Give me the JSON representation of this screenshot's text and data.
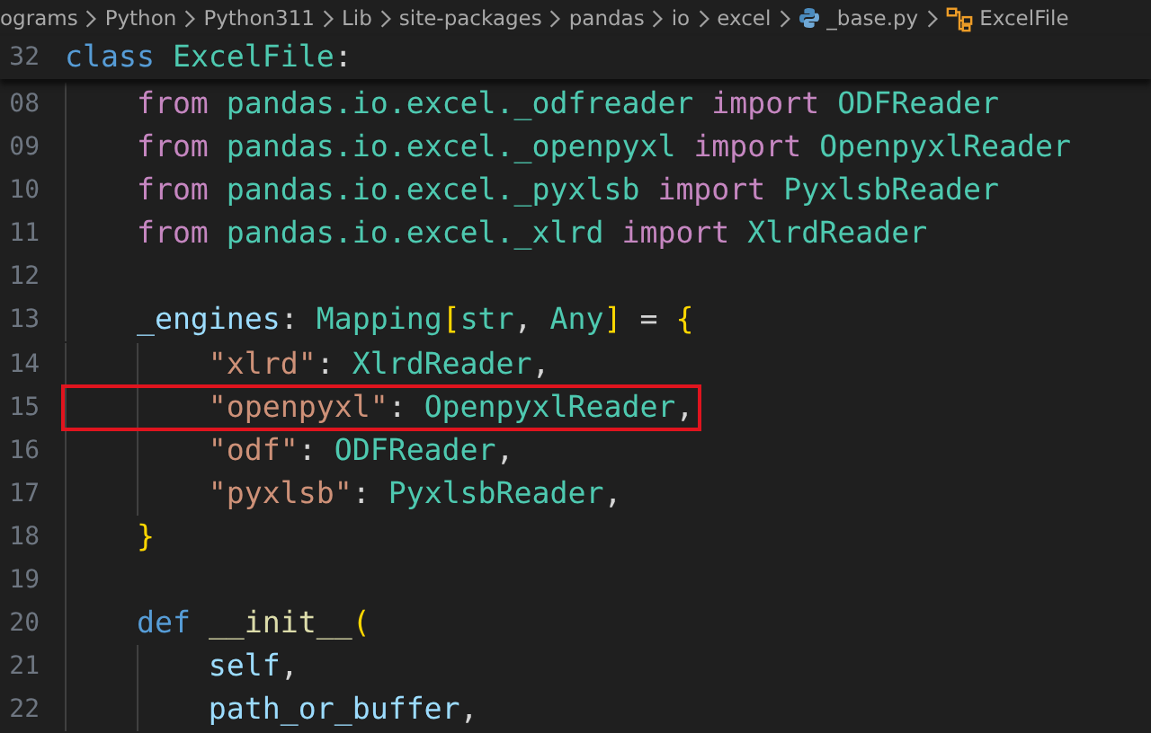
{
  "breadcrumbs": [
    {
      "label": "ograms",
      "kind": "folder"
    },
    {
      "label": "Python",
      "kind": "folder"
    },
    {
      "label": "Python311",
      "kind": "folder"
    },
    {
      "label": "Lib",
      "kind": "folder"
    },
    {
      "label": "site-packages",
      "kind": "folder"
    },
    {
      "label": "pandas",
      "kind": "folder"
    },
    {
      "label": "io",
      "kind": "folder"
    },
    {
      "label": "excel",
      "kind": "folder"
    },
    {
      "label": "_base.py",
      "kind": "python-file"
    },
    {
      "label": "ExcelFile",
      "kind": "class-symbol"
    }
  ],
  "sticky_line": {
    "number": "32",
    "tokens": [
      {
        "text": "class ",
        "kind": "keyword"
      },
      {
        "text": "ExcelFile",
        "kind": "type"
      },
      {
        "text": ":",
        "kind": "plain"
      }
    ]
  },
  "lines": [
    {
      "number": "08",
      "highlighted": false,
      "tokens": [
        {
          "text": "    from",
          "kind": "control"
        },
        {
          "text": " pandas.io.excel._odfreader ",
          "kind": "type"
        },
        {
          "text": "import",
          "kind": "control"
        },
        {
          "text": " ODFReader",
          "kind": "type"
        }
      ]
    },
    {
      "number": "09",
      "highlighted": false,
      "tokens": [
        {
          "text": "    from",
          "kind": "control"
        },
        {
          "text": " pandas.io.excel._openpyxl ",
          "kind": "type"
        },
        {
          "text": "import",
          "kind": "control"
        },
        {
          "text": " OpenpyxlReader",
          "kind": "type"
        }
      ]
    },
    {
      "number": "10",
      "highlighted": false,
      "tokens": [
        {
          "text": "    from",
          "kind": "control"
        },
        {
          "text": " pandas.io.excel._pyxlsb ",
          "kind": "type"
        },
        {
          "text": "import",
          "kind": "control"
        },
        {
          "text": " PyxlsbReader",
          "kind": "type"
        }
      ]
    },
    {
      "number": "11",
      "highlighted": false,
      "tokens": [
        {
          "text": "    from",
          "kind": "control"
        },
        {
          "text": " pandas.io.excel._xlrd ",
          "kind": "type"
        },
        {
          "text": "import",
          "kind": "control"
        },
        {
          "text": " XlrdReader",
          "kind": "type"
        }
      ]
    },
    {
      "number": "12",
      "highlighted": false
    },
    {
      "number": "13",
      "highlighted": false,
      "tokens": [
        {
          "text": "    _engines",
          "kind": "variable"
        },
        {
          "text": ": ",
          "kind": "plain"
        },
        {
          "text": "Mapping",
          "kind": "type"
        },
        {
          "text": "[",
          "kind": "bracket"
        },
        {
          "text": "str",
          "kind": "type"
        },
        {
          "text": ", ",
          "kind": "plain"
        },
        {
          "text": "Any",
          "kind": "type"
        },
        {
          "text": "]",
          "kind": "bracket"
        },
        {
          "text": " = ",
          "kind": "plain"
        },
        {
          "text": "{",
          "kind": "bracket"
        }
      ]
    },
    {
      "number": "14",
      "highlighted": false,
      "tokens": [
        {
          "text": "        \"xlrd\"",
          "kind": "string"
        },
        {
          "text": ": ",
          "kind": "plain"
        },
        {
          "text": "XlrdReader",
          "kind": "type"
        },
        {
          "text": ",",
          "kind": "plain"
        }
      ]
    },
    {
      "number": "15",
      "highlighted": true,
      "tokens": [
        {
          "text": "        \"openpyxl\"",
          "kind": "string"
        },
        {
          "text": ": ",
          "kind": "plain"
        },
        {
          "text": "OpenpyxlReader",
          "kind": "type"
        },
        {
          "text": ",",
          "kind": "plain"
        }
      ]
    },
    {
      "number": "16",
      "highlighted": false,
      "tokens": [
        {
          "text": "        \"odf\"",
          "kind": "string"
        },
        {
          "text": ": ",
          "kind": "plain"
        },
        {
          "text": "ODFReader",
          "kind": "type"
        },
        {
          "text": ",",
          "kind": "plain"
        }
      ]
    },
    {
      "number": "17",
      "highlighted": false,
      "tokens": [
        {
          "text": "        \"pyxlsb\"",
          "kind": "string"
        },
        {
          "text": ": ",
          "kind": "plain"
        },
        {
          "text": "PyxlsbReader",
          "kind": "type"
        },
        {
          "text": ",",
          "kind": "plain"
        }
      ]
    },
    {
      "number": "18",
      "highlighted": false,
      "tokens": [
        {
          "text": "    }",
          "kind": "bracket"
        }
      ]
    },
    {
      "number": "19",
      "highlighted": false
    },
    {
      "number": "20",
      "highlighted": false,
      "tokens": [
        {
          "text": "    def ",
          "kind": "keyword"
        },
        {
          "text": "__init__",
          "kind": "function"
        },
        {
          "text": "(",
          "kind": "bracket"
        }
      ]
    },
    {
      "number": "21",
      "highlighted": false,
      "tokens": [
        {
          "text": "        self",
          "kind": "variable"
        },
        {
          "text": ",",
          "kind": "plain"
        }
      ]
    },
    {
      "number": "22",
      "highlighted": false,
      "tokens": [
        {
          "text": "        path_or_buffer",
          "kind": "variable"
        },
        {
          "text": ",",
          "kind": "plain"
        }
      ]
    }
  ]
}
